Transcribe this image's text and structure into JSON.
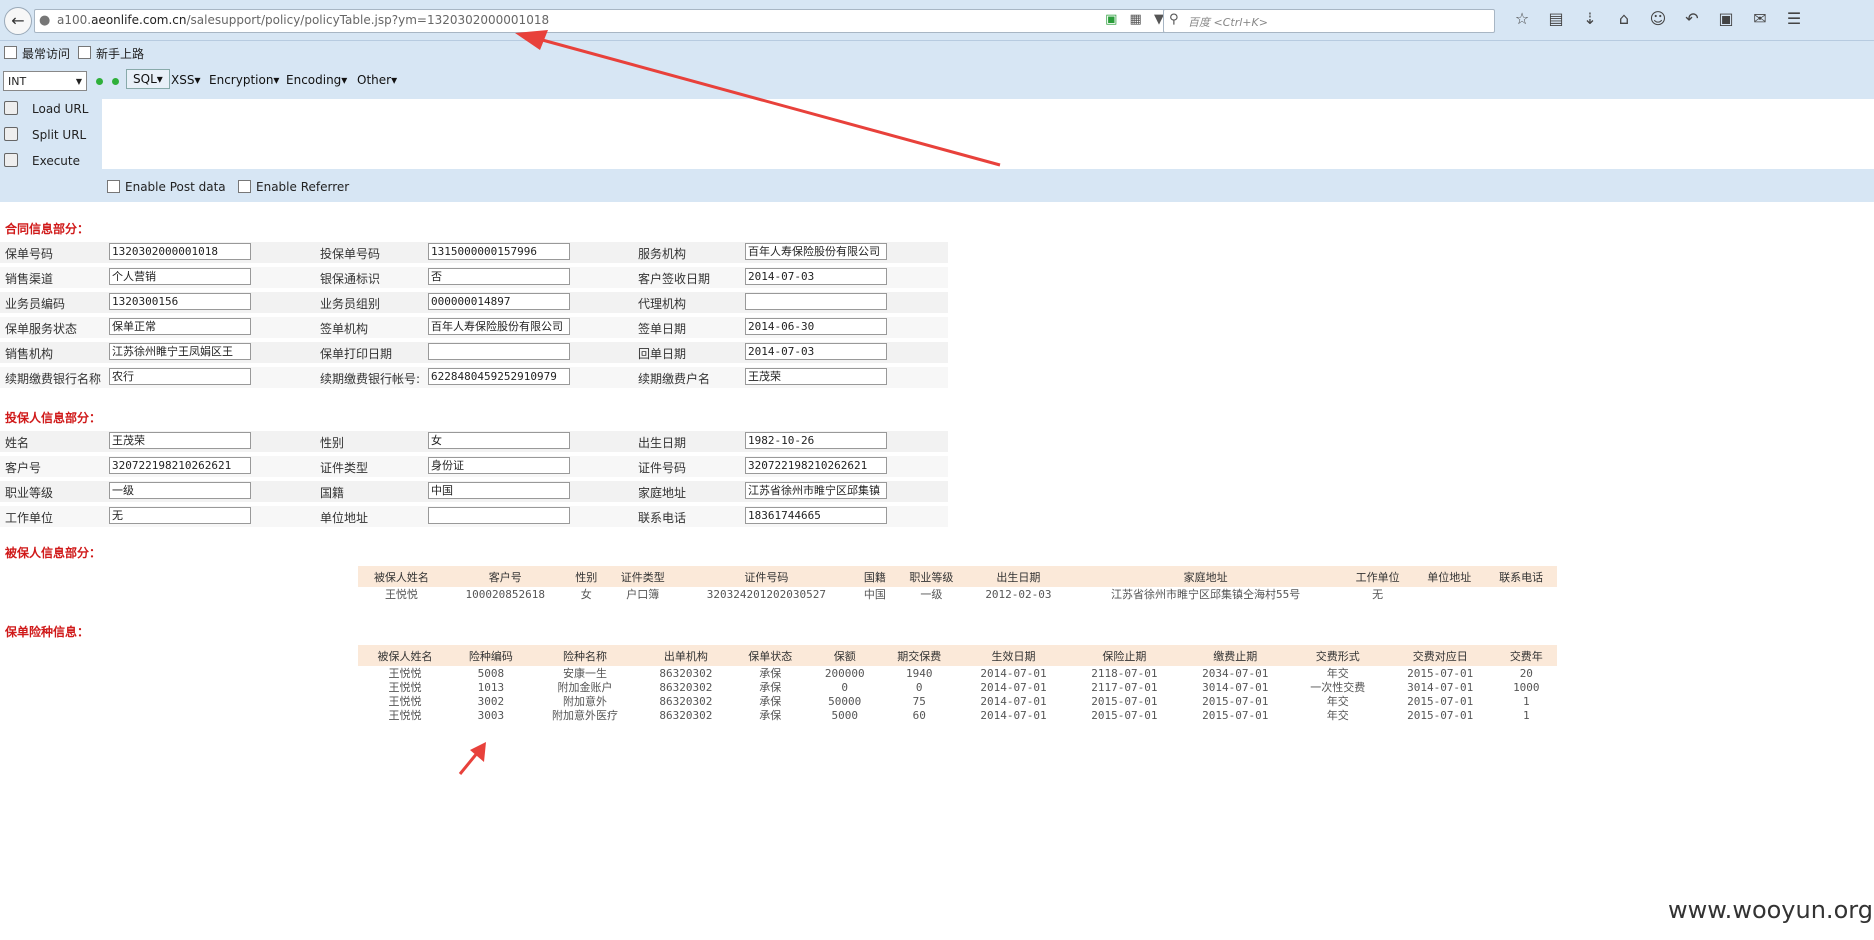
{
  "browser": {
    "url_prefix": "a100.",
    "url_domain": "aeonlife.com.cn",
    "url_path": "/salesupport/policy/policyTable.jsp?ym=1320302000001018",
    "search_placeholder": "百度 <Ctrl+K>",
    "bookmarks": [
      "最常访问",
      "新手上路"
    ]
  },
  "hackbar": {
    "select_value": "INT",
    "menus": [
      "SQL▾",
      "XSS▾",
      "Encryption▾",
      "Encoding▾",
      "Other▾"
    ],
    "actions": [
      "Load URL",
      "Split URL",
      "Execute"
    ],
    "checkboxes": [
      "Enable Post data",
      "Enable Referrer"
    ]
  },
  "sections": {
    "contract": "合同信息部分：",
    "holder": "投保人信息部分：",
    "insured": "被保人信息部分：",
    "products": "保单险种信息："
  },
  "contract_rows": [
    [
      [
        "保单号码",
        "1320302000001018"
      ],
      [
        "投保单号码",
        "1315000000157996"
      ],
      [
        "服务机构",
        "百年人寿保险股份有限公司"
      ]
    ],
    [
      [
        "销售渠道",
        "个人营销"
      ],
      [
        "银保通标识",
        "否"
      ],
      [
        "客户签收日期",
        "2014-07-03"
      ]
    ],
    [
      [
        "业务员编码",
        "1320300156"
      ],
      [
        "业务员组别",
        "000000014897"
      ],
      [
        "代理机构",
        ""
      ]
    ],
    [
      [
        "保单服务状态",
        "保单正常"
      ],
      [
        "签单机构",
        "百年人寿保险股份有限公司"
      ],
      [
        "签单日期",
        "2014-06-30"
      ]
    ],
    [
      [
        "销售机构",
        "江苏徐州睢宁王凤娟区王"
      ],
      [
        "保单打印日期",
        ""
      ],
      [
        "回单日期",
        "2014-07-03"
      ]
    ],
    [
      [
        "续期缴费银行名称",
        "农行"
      ],
      [
        "续期缴费银行帐号:",
        "6228480459252910979"
      ],
      [
        "续期缴费户名",
        "王茂荣"
      ]
    ]
  ],
  "holder_rows": [
    [
      [
        "姓名",
        "王茂荣"
      ],
      [
        "性别",
        "女"
      ],
      [
        "出生日期",
        "1982-10-26"
      ]
    ],
    [
      [
        "客户号",
        "320722198210262621"
      ],
      [
        "证件类型",
        "身份证"
      ],
      [
        "证件号码",
        "320722198210262621"
      ]
    ],
    [
      [
        "职业等级",
        "一级"
      ],
      [
        "国籍",
        "中国"
      ],
      [
        "家庭地址",
        "江苏省徐州市睢宁区邱集镇"
      ]
    ],
    [
      [
        "工作单位",
        "无"
      ],
      [
        "单位地址",
        ""
      ],
      [
        "联系电话",
        "18361744665"
      ]
    ]
  ],
  "insured_table": {
    "headers": [
      "被保人姓名",
      "客户号",
      "性别",
      "证件类型",
      "证件号码",
      "国籍",
      "职业等级",
      "出生日期",
      "家庭地址",
      "工作单位",
      "单位地址",
      "联系电话"
    ],
    "rows": [
      [
        "王悦悦",
        "100020852618",
        "女",
        "户口簿",
        "320324201202030527",
        "中国",
        "一级",
        "2012-02-03",
        "江苏省徐州市睢宁区邱集镇仝海村55号",
        "无",
        "",
        ""
      ]
    ]
  },
  "product_table": {
    "headers": [
      "被保人姓名",
      "险种编码",
      "险种名称",
      "出单机构",
      "保单状态",
      "保额",
      "期交保费",
      "生效日期",
      "保险止期",
      "缴费止期",
      "交费形式",
      "交费对应日",
      "交费年"
    ],
    "rows": [
      [
        "王悦悦",
        "5008",
        "安康一生",
        "86320302",
        "承保",
        "200000",
        "1940",
        "2014-07-01",
        "2118-07-01",
        "2034-07-01",
        "年交",
        "2015-07-01",
        "20"
      ],
      [
        "王悦悦",
        "1013",
        "附加金账户",
        "86320302",
        "承保",
        "0",
        "0",
        "2014-07-01",
        "2117-07-01",
        "3014-07-01",
        "一次性交费",
        "3014-07-01",
        "1000"
      ],
      [
        "王悦悦",
        "3002",
        "附加意外",
        "86320302",
        "承保",
        "50000",
        "75",
        "2014-07-01",
        "2015-07-01",
        "2015-07-01",
        "年交",
        "2015-07-01",
        "1"
      ],
      [
        "王悦悦",
        "3003",
        "附加意外医疗",
        "86320302",
        "承保",
        "5000",
        "60",
        "2014-07-01",
        "2015-07-01",
        "2015-07-01",
        "年交",
        "2015-07-01",
        "1"
      ]
    ]
  },
  "watermark": "www.wooyun.org"
}
